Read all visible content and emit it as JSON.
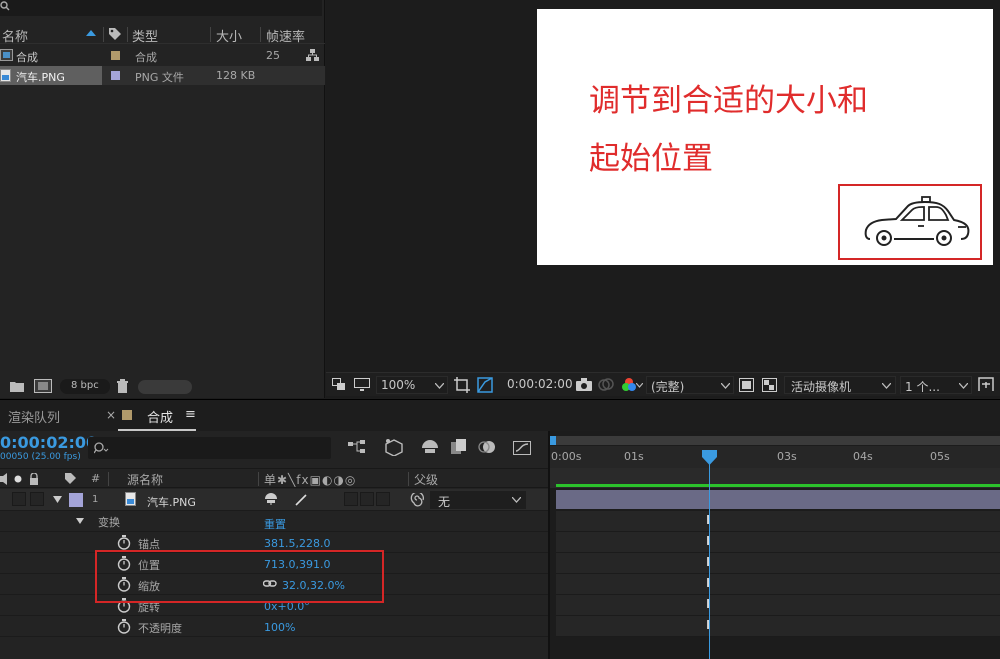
{
  "project": {
    "columns": {
      "name": "名称",
      "type": "类型",
      "size": "大小",
      "fps": "帧速率"
    },
    "items": [
      {
        "name": "合成",
        "type": "合成",
        "size": "",
        "fps": "25",
        "color": "#b19a6b"
      },
      {
        "name": "汽车.PNG",
        "type": "PNG 文件",
        "size": "128 KB",
        "fps": "",
        "color": "#a4a4d8"
      }
    ],
    "footer": {
      "bpc": "8 bpc"
    }
  },
  "viewer": {
    "canvas_text_line1": "调节到合适的大小和",
    "canvas_text_line2": "起始位置",
    "toolbar": {
      "zoom": "100%",
      "timecode": "0:00:02:00",
      "quality": "(完整)",
      "camera": "活动摄像机",
      "views": "1 个..."
    }
  },
  "timeline": {
    "tabs": [
      {
        "label": "渲染队列"
      },
      {
        "label": "合成",
        "close": "×",
        "menu": "≡"
      }
    ],
    "timecode": "0:00:02:00",
    "timecode_sub": "00050 (25.00 fps)",
    "header": {
      "hash": "#",
      "source_name": "源名称",
      "switches": "单✱╲fx▣◐◑◎",
      "parent": "父级"
    },
    "layer": {
      "index": "1",
      "name": "汽车.PNG",
      "parent": "无",
      "label_color": "#a4a4d8"
    },
    "transform": {
      "label": "变换",
      "reset": "重置"
    },
    "properties": [
      {
        "name": "锚点",
        "value": "381.5,228.0"
      },
      {
        "name": "位置",
        "value": "713.0,391.0"
      },
      {
        "name": "缩放",
        "value": "32.0,32.0%"
      },
      {
        "name": "旋转",
        "value": "0x+0.0°"
      },
      {
        "name": "不透明度",
        "value": "100%"
      }
    ],
    "ruler": [
      "0:00s",
      "01s",
      "",
      "03s",
      "04s",
      "05s"
    ],
    "accent": "#3a9ae0"
  }
}
